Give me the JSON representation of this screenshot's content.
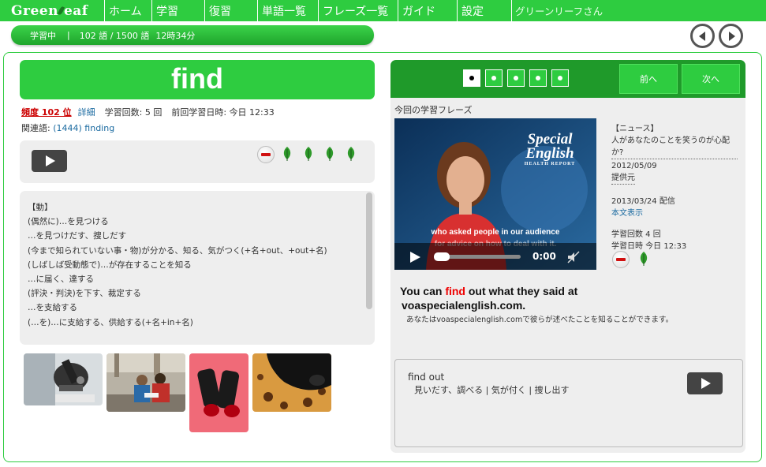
{
  "nav": {
    "logo": "Green",
    "logo_tail": "eaf",
    "items": [
      "ホーム",
      "学習",
      "復習",
      "単語一覧",
      "フレーズ一覧",
      "ガイド",
      "設定"
    ],
    "user": "グリーンリーフさん"
  },
  "status": {
    "mode": "学習中",
    "separator": "|",
    "progress": "102 語 / 1500 語",
    "time": "12時34分"
  },
  "word": {
    "headword": "find",
    "frequency": "頻度 102 位",
    "details_link": "詳細",
    "study_count": "学習回数: 5 回",
    "last_studied": "前回学習日時: 今日 12:33",
    "related_label": "関連語:",
    "related_link": "(1444) finding"
  },
  "definitions": [
    "【動】",
    "(偶然に)…を見つける",
    "…を見つけだす、捜しだす",
    "(今まで知られていない事・物)が分かる、知る、気がつく(+名+out、+out+名)",
    "(しばしば受動態で)…が存在することを知る",
    "…に届く、達する",
    "(評決・判決)を下す、裁定する",
    "…を支給する",
    "(…を)…に支給する、供給する(+名+in+名)"
  ],
  "right": {
    "pager_count": 5,
    "prev_label": "前へ",
    "next_label": "次へ",
    "phrase_title": "今回の学習フレーズ",
    "video": {
      "brand_line1": "Special",
      "brand_line2": "English",
      "brand_sub": "HEALTH REPORT",
      "caption1": "who asked people in our audience",
      "caption2": "for advice on how to deal with it.",
      "time": "0:00"
    },
    "news": {
      "tag": "【ニュース】",
      "title": "人があなたのことを笑うのが心配か?",
      "date": "2012/05/09",
      "provider": "提供元",
      "delivered": "2013/03/24 配信",
      "fulltext_link": "本文表示",
      "count": "学習回数 4 回",
      "when": "学習日時 今日 12:33"
    },
    "sentence_pre": "You can ",
    "sentence_hl": "find",
    "sentence_post": " out what they said at",
    "sentence_line2": "voaspecialenglish.com.",
    "translation": "あなたはvoaspecialenglish.comで彼らが述べたことを知ることができます。",
    "phrase": {
      "en": "find out",
      "ja": "見いだす、調べる | 気が付く | 捜し出す"
    }
  },
  "colors": {
    "brand_green": "#2ecc40",
    "dark_green": "#1f9a2a",
    "highlight_red": "#e00000"
  }
}
